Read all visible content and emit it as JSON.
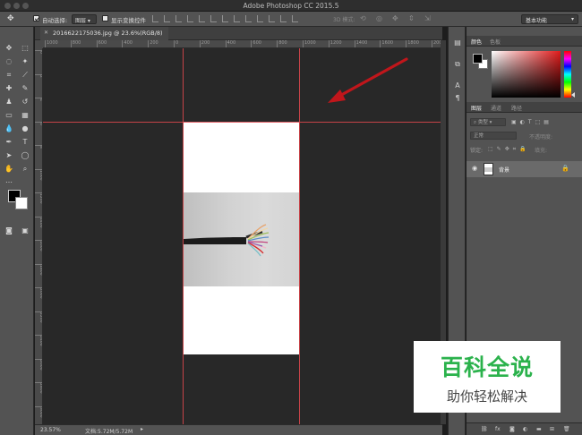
{
  "app": {
    "title": "Adobe Photoshop CC 2015.5"
  },
  "options_bar": {
    "auto_select_label": "自动选择:",
    "auto_select_value": "图层",
    "show_transform_label": "显示变换控件",
    "mode_3d_label": "3D 模式:",
    "workspace_label": "基本功能"
  },
  "document": {
    "tab_title": "20166221750​36.jpg @ 23.6%(RGB/8)",
    "zoom": "23.57%",
    "doc_size": "文档:5.72M/5.72M"
  },
  "rulers": {
    "top_labels": [
      "1000",
      "800",
      "600",
      "400",
      "200",
      "0",
      "200",
      "400",
      "600",
      "800",
      "1000",
      "1200",
      "1400",
      "1600",
      "1800",
      "2000"
    ],
    "left_labels": [
      "0",
      "2",
      "4",
      "6",
      "8",
      "1000",
      "1200",
      "1400",
      "1600",
      "1800",
      "2000",
      "2200",
      "2400",
      "2600",
      "2800",
      "3000"
    ]
  },
  "panels": {
    "color_tabs": [
      "颜色",
      "色板"
    ],
    "layer_tabs": [
      "图层",
      "通道",
      "路径"
    ],
    "kind_label": "类型",
    "blend_mode": "正常",
    "opacity_label": "不透明度:",
    "lock_label": "锁定:",
    "fill_label": "填充:",
    "layers": [
      {
        "name": "背景",
        "visible": true,
        "locked": true
      }
    ]
  },
  "watermark": {
    "title": "百科全说",
    "subtitle": "助你轻松解决"
  },
  "colors": {
    "guide": "#e0484d",
    "annotation_arrow": "#c0161b",
    "brand_green": "#2bb24c"
  }
}
